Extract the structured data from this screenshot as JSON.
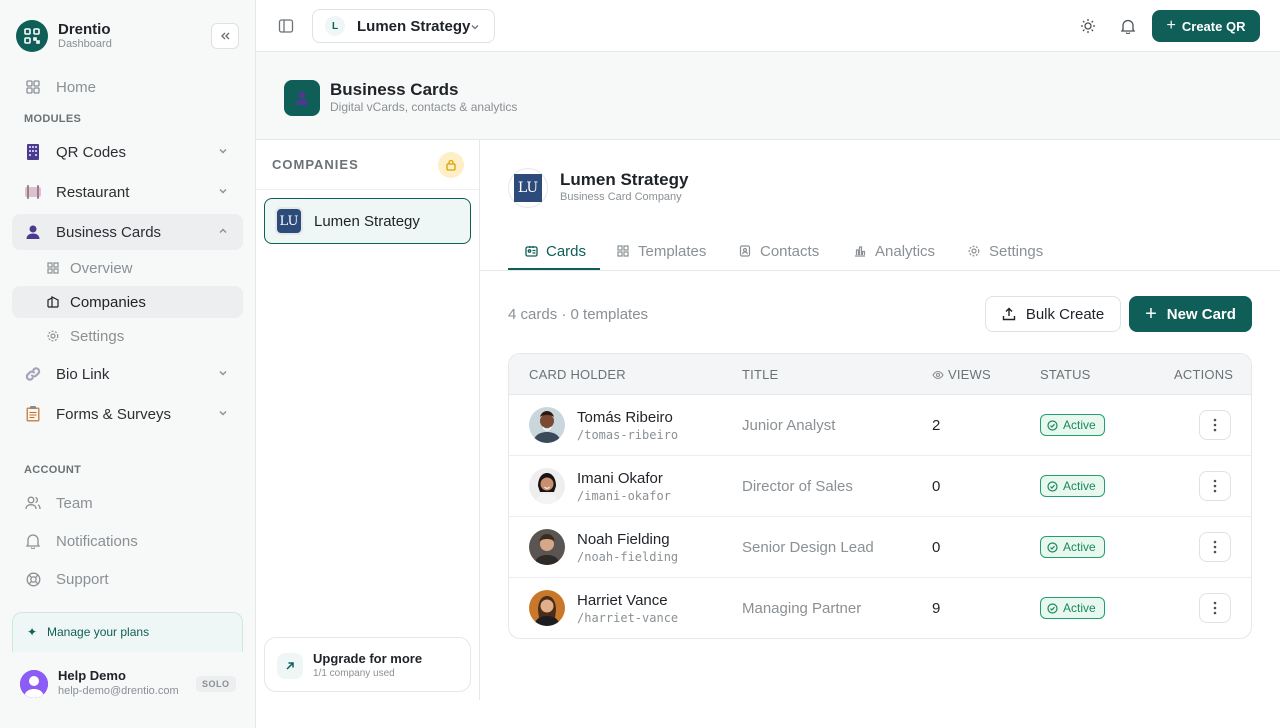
{
  "sidebar": {
    "brand_name": "Drentio",
    "brand_sub": "Dashboard",
    "home": "Home",
    "modules_label": "MODULES",
    "qr_codes": "QR Codes",
    "restaurant": "Restaurant",
    "business_cards": "Business Cards",
    "sub_overview": "Overview",
    "sub_companies": "Companies",
    "sub_settings": "Settings",
    "bio_link": "Bio Link",
    "forms": "Forms & Surveys",
    "account_label": "ACCOUNT",
    "team": "Team",
    "notifications": "Notifications",
    "support": "Support",
    "manage_plans": "Manage your plans",
    "user_name": "Help Demo",
    "user_email": "help-demo@drentio.com",
    "plan": "SOLO"
  },
  "topbar": {
    "workspace_initial": "L",
    "workspace_name": "Lumen Strategy",
    "create_label": "Create QR"
  },
  "header": {
    "title": "Business Cards",
    "subtitle": "Digital vCards, contacts & analytics"
  },
  "companies": {
    "label": "COMPANIES",
    "items": [
      {
        "initials": "LU",
        "name": "Lumen Strategy"
      }
    ],
    "upgrade_title": "Upgrade for more",
    "upgrade_sub": "1/1 company used"
  },
  "main": {
    "company_initials": "LU",
    "company_name": "Lumen Strategy",
    "company_type": "Business Card Company",
    "tabs": [
      "Cards",
      "Templates",
      "Contacts",
      "Analytics",
      "Settings"
    ],
    "counts": "4 cards · 0 templates",
    "bulk_label": "Bulk Create",
    "new_label": "New Card",
    "columns": [
      "CARD HOLDER",
      "TITLE",
      "VIEWS",
      "STATUS",
      "ACTIONS"
    ],
    "rows": [
      {
        "name": "Tomás Ribeiro",
        "slug": "/tomas-ribeiro",
        "title": "Junior Analyst",
        "views": "2",
        "status": "Active"
      },
      {
        "name": "Imani Okafor",
        "slug": "/imani-okafor",
        "title": "Director of Sales",
        "views": "0",
        "status": "Active"
      },
      {
        "name": "Noah Fielding",
        "slug": "/noah-fielding",
        "title": "Senior Design Lead",
        "views": "0",
        "status": "Active"
      },
      {
        "name": "Harriet Vance",
        "slug": "/harriet-vance",
        "title": "Managing Partner",
        "views": "9",
        "status": "Active"
      }
    ]
  },
  "colors": {
    "brand": "#0f5e57",
    "active_status": "#22a06b",
    "lock": "#f5b300"
  }
}
